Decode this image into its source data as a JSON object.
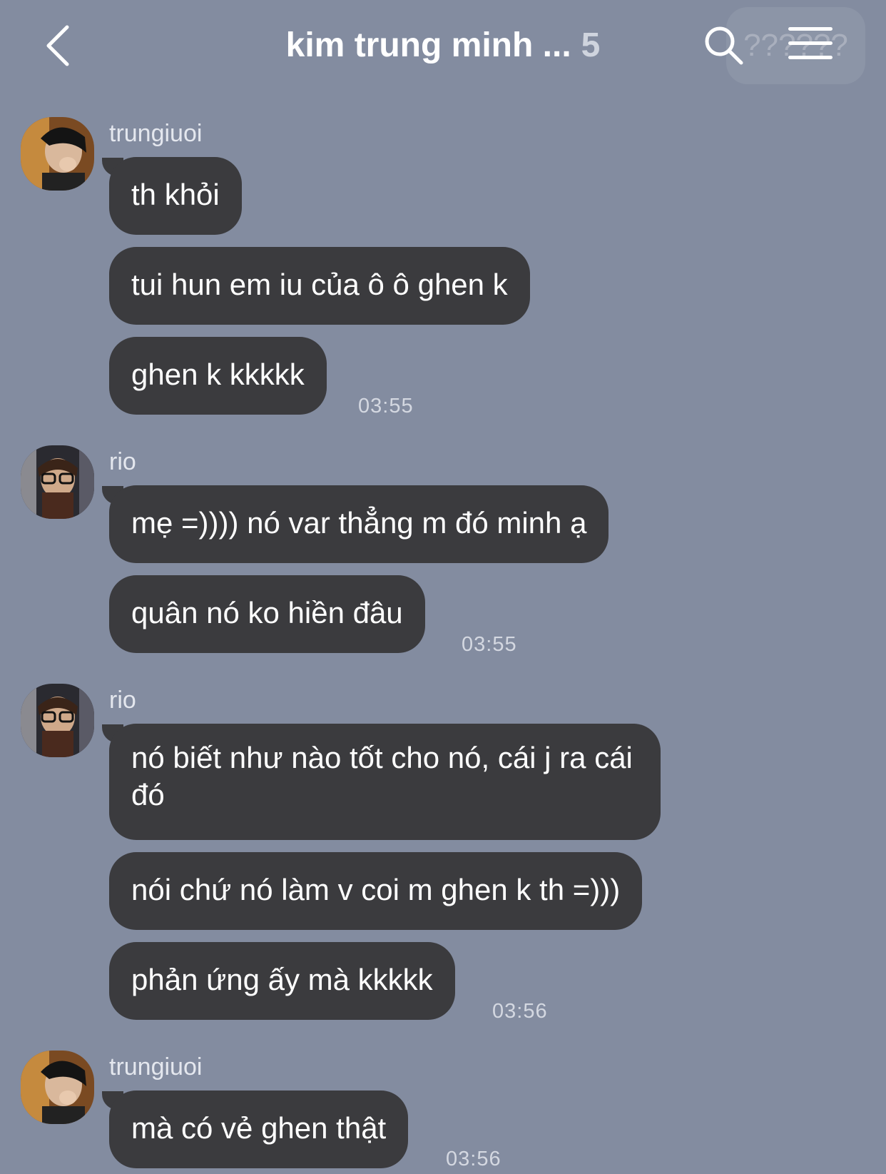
{
  "header": {
    "title": "kim trung minh ...",
    "member_count": "5",
    "ghost_text": "??????",
    "back_icon": "chevron-left-icon",
    "search_icon": "search-icon",
    "menu_icon": "menu-icon"
  },
  "messages": [
    {
      "sender": "trungiuoi",
      "text": "th khỏi"
    },
    {
      "text": "tui hun em iu của ô ô ghen k"
    },
    {
      "text": "ghen k kkkkk",
      "time": "03:55"
    },
    {
      "sender": "rio",
      "text": "mẹ =)))) nó var thẳng m đó minh ạ"
    },
    {
      "text": "quân nó ko hiền đâu",
      "time": "03:55"
    },
    {
      "sender": "rio",
      "text": "nó biết như nào tốt cho nó, cái j ra cái đó"
    },
    {
      "text": "nói chứ nó làm v coi m ghen k th =)))"
    },
    {
      "text": "phản ứng ấy mà kkkkk",
      "time": "03:56"
    },
    {
      "sender": "trungiuoi",
      "text": "mà có vẻ ghen thật",
      "time": "03:56"
    }
  ]
}
